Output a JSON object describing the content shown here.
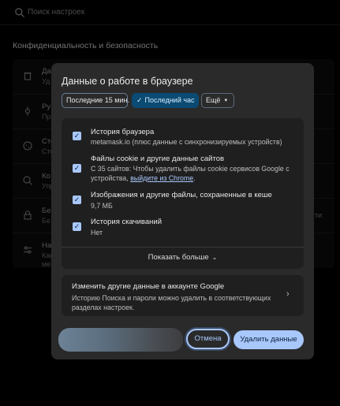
{
  "background": {
    "search_placeholder": "Поиск настроек",
    "section_title": "Конфиденциальность и безопасность",
    "rows": [
      {
        "line1": "Да",
        "line2": "Уд",
        "icon": "trash-icon"
      },
      {
        "line1": "Ру",
        "line2": "Пр",
        "icon": "guide-icon"
      },
      {
        "line1": "Сто",
        "line2": "Сто",
        "icon": "cookie-icon"
      },
      {
        "line1": "Ко",
        "line2": "Упр",
        "icon": "ad-privacy-icon"
      },
      {
        "line1": "Бе",
        "line2": "Бе",
        "icon": "lock-icon",
        "right": "ти"
      },
      {
        "line1": "На",
        "line2": "Как",
        "line3": "ме",
        "icon": "sliders-icon"
      }
    ]
  },
  "dialog": {
    "title": "Данные о работе в браузере",
    "time_chips": {
      "last_15": "Последние 15 мин.",
      "last_hour": "Последний час",
      "more": "Ещё"
    },
    "options": [
      {
        "title": "История браузера",
        "desc": "metamask.io (плюс данные с синхронизируемых устройств)",
        "checked": true
      },
      {
        "title": "Файлы cookie и другие данные сайтов",
        "desc": "С 35 сайтов: Чтобы удалить файлы cookie сервисов Google с устройства, ",
        "link": "выйдите из Chrome",
        "desc_end": ".",
        "checked": true
      },
      {
        "title": "Изображения и другие файлы, сохраненные в кеше",
        "desc": "9,7 МБ",
        "checked": true
      },
      {
        "title": "История скачиваний",
        "desc": "Нет",
        "checked": true
      }
    ],
    "show_more": "Показать больше",
    "google_card": {
      "title": "Изменить другие данные в аккаунте Google",
      "desc": "Историю Поиска и пароли можно удалить в соответствующих разделах настроек."
    },
    "cancel_label": "Отмена",
    "delete_label": "Удалить данные"
  },
  "colors": {
    "accent": "#a8c7fa",
    "selected_chip": "#0b4a72",
    "dialog_bg": "#2a2a2b",
    "panel_bg": "#1f1f20"
  }
}
